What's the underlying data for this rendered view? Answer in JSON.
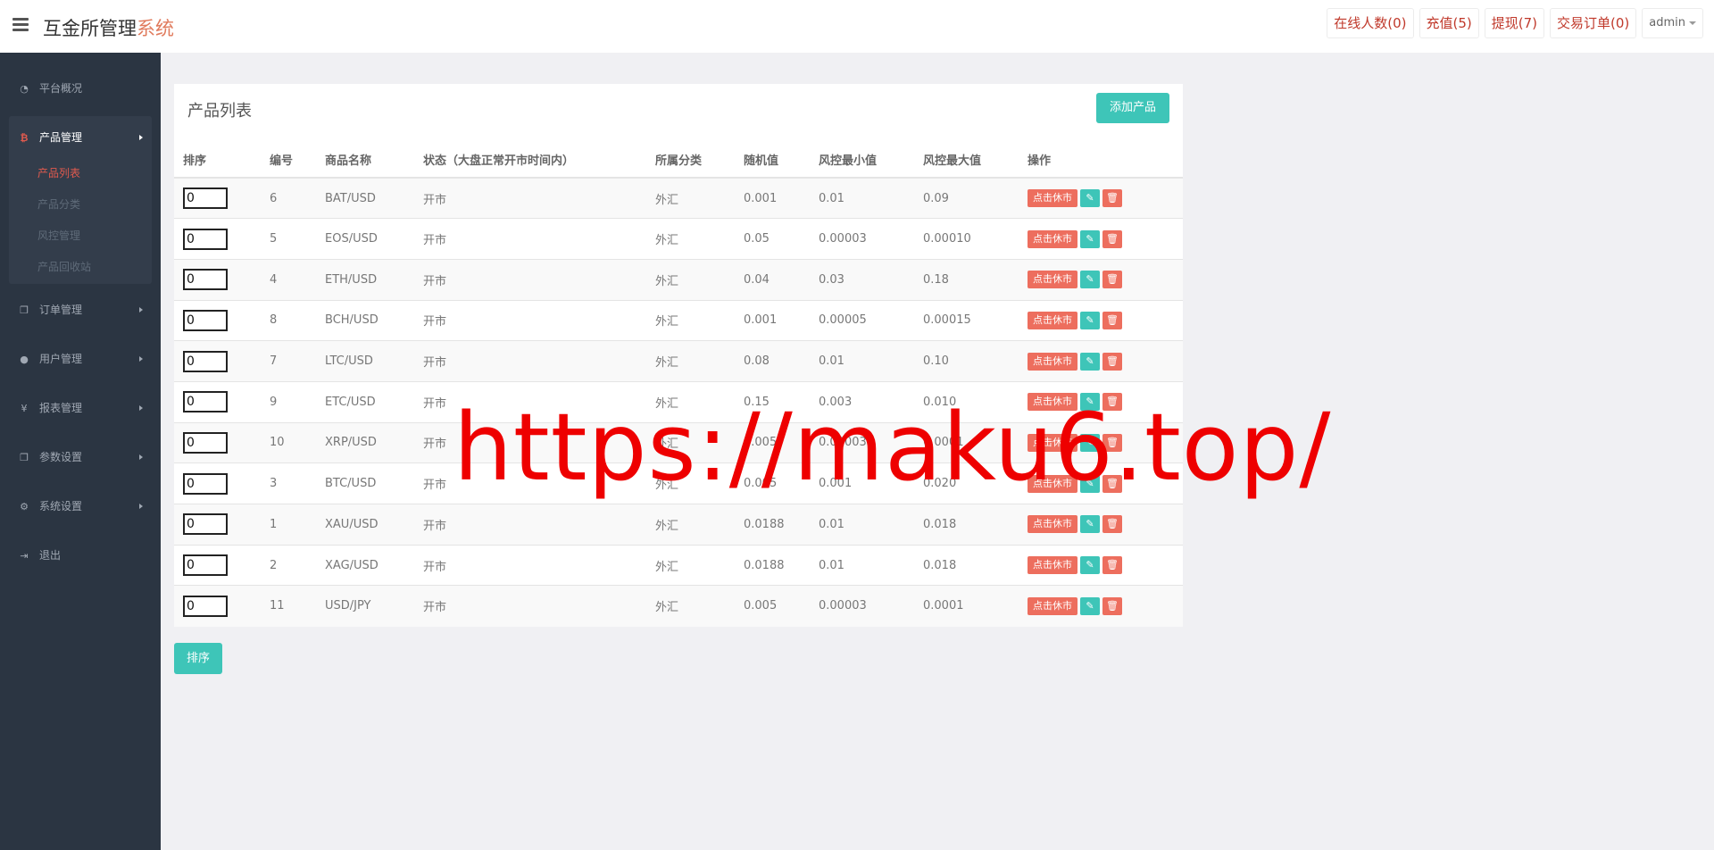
{
  "header": {
    "brand_main": "互金所管理",
    "brand_accent": "系统",
    "nav": [
      "在线人数(0)",
      "充值(5)",
      "提现(7)",
      "交易订单(0)"
    ],
    "user": "admin"
  },
  "sidebar": {
    "items": [
      {
        "label": "平台概况",
        "icon": "dashboard-icon"
      },
      {
        "label": "产品管理",
        "icon": "bitcoin-icon"
      },
      {
        "label": "订单管理",
        "icon": "copy-icon"
      },
      {
        "label": "用户管理",
        "icon": "user-icon"
      },
      {
        "label": "报表管理",
        "icon": "yen-icon"
      },
      {
        "label": "参数设置",
        "icon": "copy-icon"
      },
      {
        "label": "系统设置",
        "icon": "gears-icon"
      },
      {
        "label": "退出",
        "icon": "sign-out-icon"
      }
    ],
    "sub_items": [
      "产品列表",
      "产品分类",
      "风控管理",
      "产品回收站"
    ]
  },
  "panel": {
    "title": "产品列表",
    "add_button": "添加产品",
    "sort_button": "排序"
  },
  "table": {
    "headers": [
      "排序",
      "编号",
      "商品名称",
      "状态（大盘正常开市时间内）",
      "所属分类",
      "随机值",
      "风控最小值",
      "风控最大值",
      "操作"
    ],
    "close_label": "点击休市",
    "rows": [
      {
        "sort": "0",
        "id": "6",
        "name": "BAT/USD",
        "status": "开市",
        "category": "外汇",
        "random": "0.001",
        "min": "0.01",
        "max": "0.09"
      },
      {
        "sort": "0",
        "id": "5",
        "name": "EOS/USD",
        "status": "开市",
        "category": "外汇",
        "random": "0.05",
        "min": "0.00003",
        "max": "0.00010"
      },
      {
        "sort": "0",
        "id": "4",
        "name": "ETH/USD",
        "status": "开市",
        "category": "外汇",
        "random": "0.04",
        "min": "0.03",
        "max": "0.18"
      },
      {
        "sort": "0",
        "id": "8",
        "name": "BCH/USD",
        "status": "开市",
        "category": "外汇",
        "random": "0.001",
        "min": "0.00005",
        "max": "0.00015"
      },
      {
        "sort": "0",
        "id": "7",
        "name": "LTC/USD",
        "status": "开市",
        "category": "外汇",
        "random": "0.08",
        "min": "0.01",
        "max": "0.10"
      },
      {
        "sort": "0",
        "id": "9",
        "name": "ETC/USD",
        "status": "开市",
        "category": "外汇",
        "random": "0.15",
        "min": "0.003",
        "max": "0.010"
      },
      {
        "sort": "0",
        "id": "10",
        "name": "XRP/USD",
        "status": "开市",
        "category": "外汇",
        "random": "0.005",
        "min": "0.00003",
        "max": "0.0001"
      },
      {
        "sort": "0",
        "id": "3",
        "name": "BTC/USD",
        "status": "开市",
        "category": "外汇",
        "random": "0.005",
        "min": "0.001",
        "max": "0.020"
      },
      {
        "sort": "0",
        "id": "1",
        "name": "XAU/USD",
        "status": "开市",
        "category": "外汇",
        "random": "0.0188",
        "min": "0.01",
        "max": "0.018"
      },
      {
        "sort": "0",
        "id": "2",
        "name": "XAG/USD",
        "status": "开市",
        "category": "外汇",
        "random": "0.0188",
        "min": "0.01",
        "max": "0.018"
      },
      {
        "sort": "0",
        "id": "11",
        "name": "USD/JPY",
        "status": "开市",
        "category": "外汇",
        "random": "0.005",
        "min": "0.00003",
        "max": "0.0001"
      }
    ]
  },
  "watermark": "https://maku6.top/"
}
